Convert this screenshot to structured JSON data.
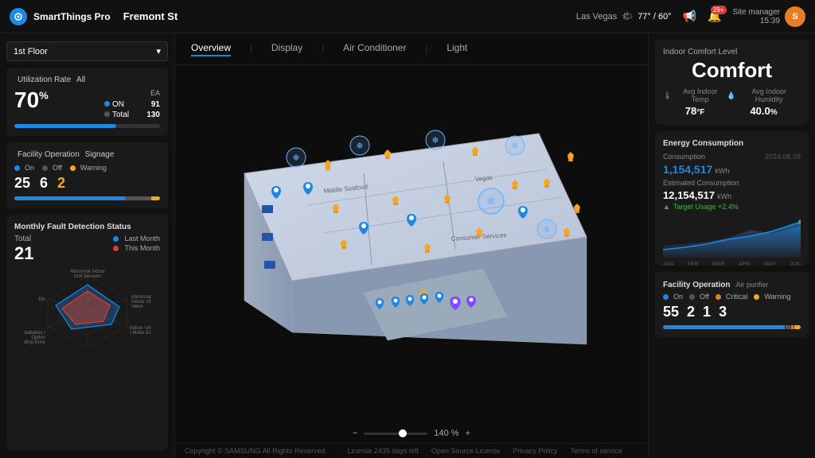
{
  "header": {
    "logo_text": "SmartThings Pro",
    "location": "Fremont St",
    "weather_city": "Las Vegas",
    "weather_icon": "🌤",
    "temp_high": "77°",
    "temp_low": "60°",
    "notifications_count": "29+",
    "site_manager_label": "Site manager",
    "site_manager_time": "15:39",
    "avatar_letter": "S"
  },
  "sidebar": {
    "floor_select": "1st Floor",
    "utilization_rate": {
      "title": "Utilization Rate",
      "subtitle": "All",
      "unit": "EA",
      "percent": "70",
      "percent_suffix": "%",
      "on_label": "ON",
      "on_value": "91",
      "total_label": "Total",
      "total_value": "130",
      "bar_fill_percent": "70"
    },
    "facility_operation": {
      "title": "Facility Operation",
      "subtitle": "Signage",
      "on_label": "On",
      "off_label": "Off",
      "warning_label": "Warning",
      "on_value": "25",
      "off_value": "6",
      "warning_value": "2"
    },
    "monthly_fault": {
      "title": "Monthly Fault Detection Status",
      "total_label": "Total",
      "total_value": "21",
      "last_month_label": "Last Month",
      "this_month_label": "This Month",
      "radar_labels": [
        "Abnormal Indoor Unit Sensors",
        "Abnormal Indoor Unit Valve",
        "Indoor Unit Fan / Motor Error",
        "Installation / Option Setting Error",
        "Etc"
      ]
    }
  },
  "tabs": {
    "items": [
      "Overview",
      "Display",
      "Air Conditioner",
      "Light"
    ],
    "active": "Overview"
  },
  "zoom": {
    "level": "140 %",
    "minus": "−",
    "plus": "+"
  },
  "footer": {
    "copyright": "Copyright © SAMSUNG All Rights Reserved",
    "license_text": "License 2435 days left",
    "open_source": "Open Source License",
    "privacy": "Privacy Policy",
    "terms": "Terms of service"
  },
  "right_panel": {
    "comfort": {
      "title": "Indoor Comfort Level",
      "level": "Comfort",
      "temp_label": "Avg Indoor Temp",
      "temp_value": "78",
      "temp_unit": "°F",
      "humidity_label": "Avg Indoor Humidity",
      "humidity_value": "40.0",
      "humidity_unit": "%"
    },
    "energy": {
      "title": "Energy Consumption",
      "consumption_label": "Consumption",
      "consumption_date": "2024.06.09",
      "consumption_value": "1,154,517",
      "consumption_unit": "kWh",
      "estimated_label": "Estimated Consumption",
      "estimated_value": "12,154,517",
      "estimated_unit": "kWh",
      "target_label": "Target Usage +2.4%",
      "chart_months": [
        "JAN",
        "FEB",
        "MAR",
        "APR",
        "MAY",
        "JUN"
      ]
    },
    "facility_operation_bottom": {
      "title": "Facility Operation",
      "subtitle": "Air purifier",
      "on_label": "On",
      "off_label": "Off",
      "critical_label": "Critical",
      "warning_label": "Warning",
      "on_value": "55",
      "off_value": "2",
      "critical_value": "1",
      "warning_value": "3"
    }
  }
}
